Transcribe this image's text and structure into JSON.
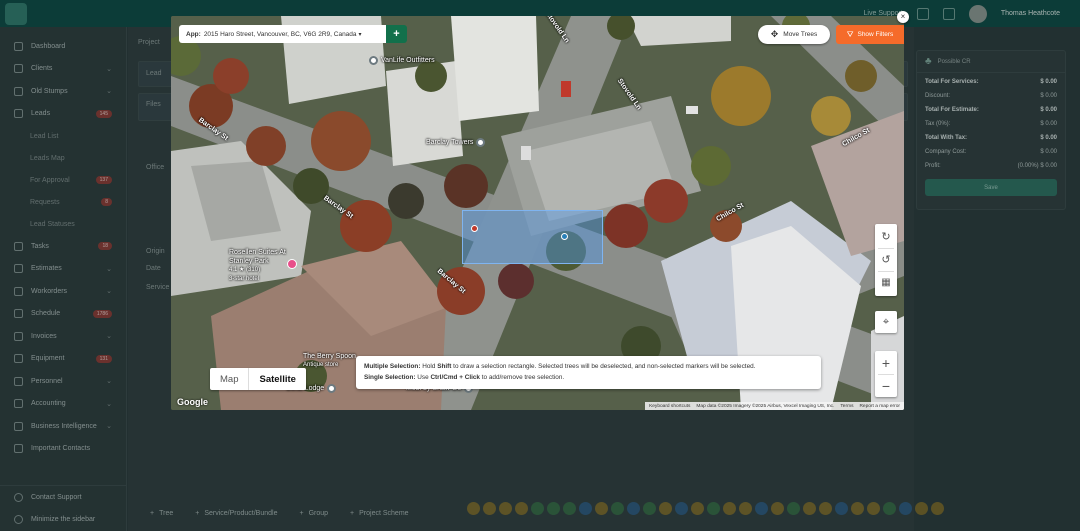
{
  "topbar": {
    "live_label": "Live Support",
    "user_name": "Thomas Heathcote"
  },
  "sidebar": {
    "items": [
      {
        "label": "Dashboard",
        "icon": "dashboard-icon"
      },
      {
        "label": "Clients",
        "icon": "clients-icon",
        "chevron": "⌄"
      },
      {
        "label": "Old Stumps",
        "icon": "stumps-icon",
        "chevron": "⌄"
      },
      {
        "label": "Leads",
        "icon": "leads-icon",
        "badge": "145"
      },
      {
        "label": "Lead List",
        "sub": true
      },
      {
        "label": "Leads Map",
        "sub": true
      },
      {
        "label": "For Approval",
        "sub": true,
        "badge": "137"
      },
      {
        "label": "Requests",
        "sub": true,
        "badge": "8"
      },
      {
        "label": "Lead Statuses",
        "sub": true
      },
      {
        "label": "Tasks",
        "icon": "tasks-icon",
        "badge": "18"
      },
      {
        "label": "Estimates",
        "icon": "estimates-icon",
        "chevron": "⌄"
      },
      {
        "label": "Workorders",
        "icon": "workorders-icon",
        "chevron": "⌄"
      },
      {
        "label": "Schedule",
        "icon": "schedule-icon",
        "badge": "1786"
      },
      {
        "label": "Invoices",
        "icon": "invoices-icon",
        "chevron": "⌄"
      },
      {
        "label": "Equipment",
        "icon": "equipment-icon",
        "badge": "131"
      },
      {
        "label": "Personnel",
        "icon": "personnel-icon",
        "chevron": "⌄"
      },
      {
        "label": "Accounting",
        "icon": "accounting-icon",
        "chevron": "⌄"
      },
      {
        "label": "Business Intelligence",
        "icon": "bi-icon",
        "chevron": "⌄"
      },
      {
        "label": "Important Contacts",
        "icon": "contacts-icon"
      }
    ],
    "bottom": [
      {
        "label": "Contact Support",
        "icon": "support-icon"
      },
      {
        "label": "Minimize the sidebar",
        "icon": "minimize-icon"
      }
    ]
  },
  "main": {
    "project_label": "Project",
    "lead_label": "Lead",
    "files_label": "Files",
    "office_label": "Office",
    "origin_label": "Origin",
    "date_label": "Date",
    "service_label": "Service"
  },
  "summary": {
    "header": "Possible CR",
    "rows": [
      {
        "label": "Total For Services:",
        "value": "$ 0.00",
        "bold": true
      },
      {
        "label": "Discount:",
        "value": "$ 0.00",
        "bold": false
      },
      {
        "label": "Total For Estimate:",
        "value": "$ 0.00",
        "bold": true
      },
      {
        "label": "Tax (0%):",
        "value": "$ 0.00",
        "bold": false
      },
      {
        "label": "Total With Tax:",
        "value": "$ 0.00",
        "bold": true
      },
      {
        "label": "Company Cost:",
        "value": "$ 0.00",
        "bold": false
      },
      {
        "label": "Profit:",
        "value": "(0.00%) $ 0.00",
        "bold": false
      }
    ],
    "save_label": "Save"
  },
  "bottom_bar": {
    "add_items": [
      "Tree",
      "Service/Product/Bundle",
      "Group",
      "Project Scheme"
    ]
  },
  "dot_colors": [
    "#b58a1e",
    "#b58a1e",
    "#b58a1e",
    "#b58a1e",
    "#3a8a4a",
    "#3a8a4a",
    "#3a8a4a",
    "#2a6fb0",
    "#b58a1e",
    "#3a8a4a",
    "#2a6fb0",
    "#3a8a4a",
    "#b58a1e",
    "#2a6fb0",
    "#b58a1e",
    "#3a8a4a",
    "#b58a1e",
    "#b58a1e",
    "#2a6fb0",
    "#b58a1e",
    "#3a8a4a",
    "#b58a1e",
    "#b58a1e",
    "#2a6fb0",
    "#b58a1e",
    "#b58a1e",
    "#3a8a4a",
    "#2a6fb0",
    "#b58a1e",
    "#b58a1e"
  ],
  "modal": {
    "address_prefix": "App:",
    "address": "2015 Haro Street, Vancouver, BC, V6G 2R9, Canada",
    "move_trees_label": "Move Trees",
    "show_filters_label": "Show Filters",
    "close_glyph": "×",
    "map_label": "Map",
    "satellite_label": "Satellite",
    "hint_multi_title": "Multiple Selection:",
    "hint_multi_a": "Hold",
    "hint_multi_key": "Shift",
    "hint_multi_b": "to draw a selection rectangle. Selected trees will be deselected, and non-selected markers will be selected.",
    "hint_single_title": "Single Selection:",
    "hint_single_a": "Use",
    "hint_single_key": "Ctrl/Cmd + Click",
    "hint_single_b": "to add/remove tree selection.",
    "google_label": "Google",
    "attribution": [
      "Keyboard shortcuts",
      "Map data ©2025 Imagery ©2025 Airbus, Vexcel Imaging US, Inc.",
      "Terms",
      "Report a map error"
    ],
    "pois": [
      {
        "label": "VanLife Outfitters"
      },
      {
        "label": "Barclay Towers"
      },
      {
        "label": "Rosellen Suites At Stanley Park"
      },
      {
        "label": "4.1 ★ (310)"
      },
      {
        "label": "3-star hotel"
      },
      {
        "label": "The Berry Spoon"
      },
      {
        "label": "Antique store"
      },
      {
        "label": "Coral Lodge"
      },
      {
        "label": "Mobi by Shaw Go"
      }
    ],
    "streets": [
      "Stovold Ln",
      "Stovold Ln",
      "Barclay St",
      "Barclay St",
      "Barclay St",
      "Chilco St",
      "Chilco St"
    ],
    "tree_markers": [
      "#c0392b",
      "#2980b9"
    ]
  }
}
